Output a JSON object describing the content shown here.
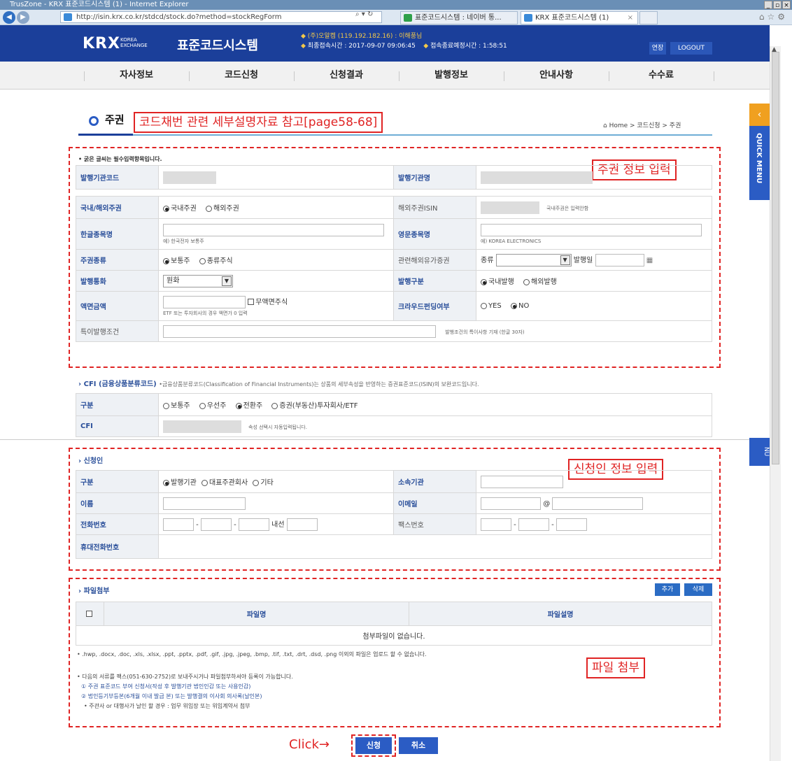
{
  "browser": {
    "window_title": "TrusZone - KRX 표준코드시스템 (1) - Internet Explorer",
    "url": "http://isin.krx.co.kr/stdcd/stock.do?method=stockRegForm",
    "tabs": [
      "표준코드시스템 : 네이버 통...",
      "KRX 표준코드시스템 (1)"
    ]
  },
  "header": {
    "logo": "KRX",
    "logo_sub": "KOREA EXCHANGE",
    "system_title": "표준코드시스템",
    "user_info": "(주)오알켐 (119.192.182.16) : 이해풍님",
    "login_time_label": "최종접속시간 : 2017-09-07 09:06:45",
    "expire_label": "접속종료예정시간 : 1:58:51",
    "extend_label": "연장",
    "logout_label": "LOGOUT"
  },
  "gnb": [
    "자사정보",
    "코드신청",
    "신청결과",
    "발행정보",
    "안내사항",
    "수수료"
  ],
  "page": {
    "title": "주권",
    "breadcrumb": "⌂ Home  >  코드신청  >  주권",
    "required_note": "• 굵은 글씨는 필수입력항목입니다."
  },
  "callouts": {
    "ref": "코드채번 관련 세부설명자료 참고[page58-68]",
    "stock_info": "주권 정보 입력",
    "applicant_info": "신청인 정보 입력",
    "file_attach": "파일 첨부",
    "click": "Click→"
  },
  "stock_form": {
    "issuer_code": "발행기관코드",
    "issuer_name": "발행기관명",
    "domestic_foreign": "국내/해외주권",
    "domestic": "국내주권",
    "foreign": "해외주권",
    "foreign_isin": "해외주권ISIN",
    "foreign_isin_note": "국내주권은 입력안함",
    "kor_name": "한글종목명",
    "kor_hint": "예) 한국전자 보통주",
    "eng_name": "영문종목명",
    "eng_hint": "예) KOREA ELECTRONICS",
    "stock_type": "주권종류",
    "common": "보통주",
    "class": "종류주식",
    "related_dr": "관련해외유가증권",
    "kind": "종류",
    "issue_date": "발행일",
    "currency": "발행통화",
    "currency_value": "원화",
    "issue_type": "발행구분",
    "domestic_issue": "국내발행",
    "foreign_issue": "해외발행",
    "par_value": "액면금액",
    "no_par": "무액면주식",
    "par_hint": "ETF 또는 투자회사의 경우 액면가 0 입력",
    "crowdfunding": "크라우드펀딩여부",
    "yes": "YES",
    "no": "NO",
    "special": "특이발행조건",
    "special_hint": "발행조건의 특이사항 기재 (한글 30자)"
  },
  "cfi": {
    "title": "› CFI (금융상품분류코드)",
    "desc": "•금융상품분류코드(Classification of Financial Instruments)는 상품의 세부속성을 반영하는 증권표준코드(ISIN)의 보완코드입니다.",
    "category": "구분",
    "opts": [
      "보통주",
      "우선주",
      "전환주",
      "증권(부동산)투자회사/ETF"
    ],
    "cfi_label": "CFI",
    "cfi_note": "속성 선택시 자동입력됩니다."
  },
  "applicant": {
    "title": "› 신청인",
    "category": "구분",
    "opts": [
      "발행기관",
      "대표주관회사",
      "기타"
    ],
    "affiliation": "소속기관",
    "name": "이름",
    "email": "이메일",
    "at": "@",
    "phone": "전화번호",
    "ext": "내선",
    "fax": "팩스번호",
    "mobile": "휴대전화번호"
  },
  "files": {
    "title": "› 파일첨부",
    "add": "추가",
    "delete": "삭제",
    "col_name": "파일명",
    "col_desc": "파일설명",
    "empty": "첨부파일이 없습니다.",
    "ext_note": "• .hwp, .docx, .doc, .xls, .xlsx, .ppt, .pptx, .pdf, .gif, .jpg, .jpeg, .bmp, .tif, .txt, .drt, .dsd, .png 이외의 파일은 업로드 할 수 없습니다.",
    "notice1": "• 다음의 서류를 팩스(051-630-2752)로 보내주시거나 파일첨부하셔야 등록이 가능합니다.",
    "notice2": "① 주권 표준코드 부여 신청서(작성 후 발행기관 법인인감 또는 사용인감)",
    "notice3": "② 법인등기부등본(6개월 이내 발급 본) 또는 발행결의 이사회 의사록(날인본)",
    "notice4": "• 주관사 or 대행사가 날인 할 경우 : 업무 위임장 또는 위임계약서 첨부"
  },
  "actions": {
    "submit": "신청",
    "cancel": "취소"
  },
  "quick_menu": "QUICK MENU"
}
